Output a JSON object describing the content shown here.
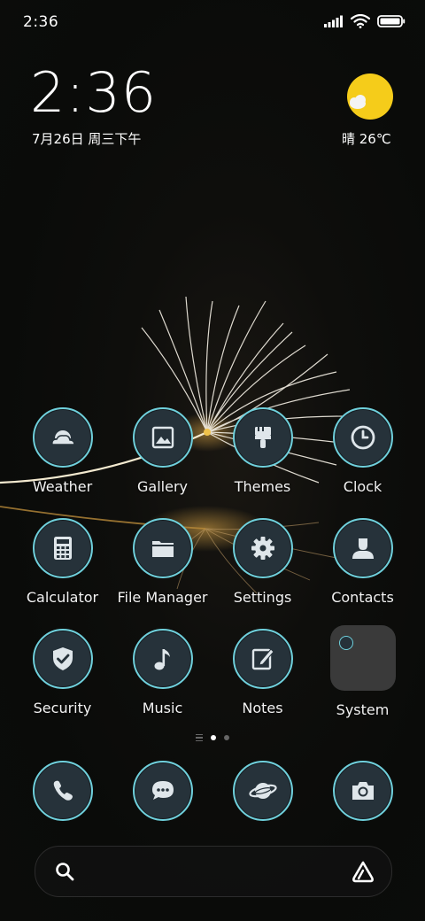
{
  "status_bar": {
    "time": "2:36"
  },
  "clock_widget": {
    "time": "2:36",
    "date": "7月26日 周三下午"
  },
  "weather": {
    "text": "晴 26℃",
    "icon": "sunny-icon"
  },
  "apps": {
    "weather": "Weather",
    "gallery": "Gallery",
    "themes": "Themes",
    "clock": "Clock",
    "calculator": "Calculator",
    "file_manager": "File Manager",
    "settings": "Settings",
    "contacts": "Contacts",
    "security": "Security",
    "music": "Music",
    "notes": "Notes",
    "system": "System"
  },
  "dock": [
    "phone-icon",
    "messages-icon",
    "browser-icon",
    "camera-icon"
  ],
  "pager": {
    "pages": 2,
    "active": 1
  },
  "colors": {
    "icon_ring": "#6fd0dc",
    "icon_bg": "#26323a",
    "sun": "#f5cc1a"
  }
}
